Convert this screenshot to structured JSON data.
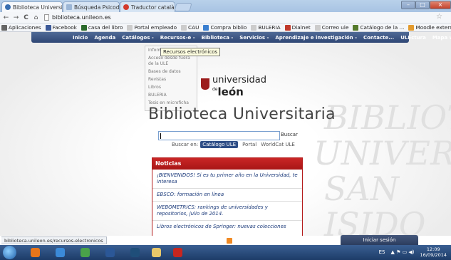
{
  "browser": {
    "tabs": [
      {
        "title": "Biblioteca Universita",
        "active": true,
        "icon_color": "#3a6fb0"
      },
      {
        "title": "Búsqueda Psicodoc",
        "active": false,
        "icon_color": "#9bb6d6"
      },
      {
        "title": "Traductor català / esp",
        "active": false,
        "icon_color": "#d33a2c"
      }
    ],
    "tab_close_glyph": "×",
    "address": "biblioteca.unileon.es",
    "nav": {
      "back": "←",
      "forward": "→",
      "reload": "C",
      "home": "⌂"
    },
    "star": "☆",
    "window_controls": {
      "minimize": "–",
      "maximize": "□",
      "close": "×"
    }
  },
  "bookmarks": [
    {
      "label": "Aplicaciones",
      "icon": "apps-icon",
      "color": "#666666"
    },
    {
      "label": "Facebook",
      "icon": "facebook-icon",
      "color": "#3b5998"
    },
    {
      "label": "casa del libro",
      "icon": "book-icon",
      "color": "#2c6b2c"
    },
    {
      "label": "Portal empleado",
      "icon": "page-icon",
      "color": "#cccccc"
    },
    {
      "label": "CAU",
      "icon": "cau-icon",
      "color": "#cccccc"
    },
    {
      "label": "Compra biblio",
      "icon": "cart-icon",
      "color": "#3a7fd0"
    },
    {
      "label": "BULERIA",
      "icon": "page-icon",
      "color": "#cccccc"
    },
    {
      "label": "Dialnet",
      "icon": "dialnet-icon",
      "color": "#c0392b"
    },
    {
      "label": "Correo ule",
      "icon": "page-icon",
      "color": "#cccccc"
    },
    {
      "label": "Catálogo de la ...",
      "icon": "catalog-icon",
      "color": "#557b2c"
    },
    {
      "label": "Moodle externo",
      "icon": "moodle-icon",
      "color": "#e39b2f"
    }
  ],
  "topnav": [
    "Inicio",
    "Agenda",
    "Catálogos -",
    "Recursos-e -",
    "Biblioteca -",
    "Servicios -",
    "Aprendizaje e investigación -",
    "Contacte...",
    "ULEctura",
    "Mapa web"
  ],
  "dropdown": {
    "items": [
      "Inform",
      "Acceso desde fuera de la ULE",
      "Bases de datos",
      "Revistas",
      "Libros",
      "BULERIA",
      "Tesis en microficha"
    ],
    "tooltip": "Recursos electrónicos"
  },
  "logo": {
    "line1": "universidad",
    "prefix": "de",
    "line2": "león"
  },
  "site_title": "Biblioteca Universitaria",
  "search": {
    "value": "",
    "button": "Buscar",
    "label": "Buscar en:",
    "options": [
      "Catálogo ULE",
      "Portal",
      "WorldCat ULE"
    ],
    "selected": "Catálogo ULE"
  },
  "news": {
    "title": "Noticias",
    "items": [
      "¡BIENVENIDOS! Si es tu primer año en la Universidad, te interesa",
      "EBSCO: formación en línea",
      "WEBOMETRICS: rankings de universidades y repositorios, julio de 2014.",
      "Libros electrónicos de Springer: nuevas colecciones"
    ]
  },
  "watermark": [
    "BIBLIOTE",
    "UNIVERSITA",
    "SAN ISIDO"
  ],
  "status_url": "biblioteca.unileon.es/recursos-electronicos",
  "login_label": "Iniciar sesión",
  "taskbar": {
    "apps": [
      {
        "name": "firefox",
        "color": "#e8751a"
      },
      {
        "name": "chrome-old",
        "color": "#3b8ad8"
      },
      {
        "name": "chrome",
        "color": "#4aa34a"
      },
      {
        "name": "word",
        "color": "#2b5797"
      },
      {
        "name": "media-player",
        "color": "#1f4e79"
      },
      {
        "name": "explorer",
        "color": "#e8c86a"
      },
      {
        "name": "acrobat",
        "color": "#c7261f"
      }
    ],
    "lang": "ES",
    "tray_icons": "▲ ⚑ ▭ ◀)",
    "time": "12:09",
    "date": "16/09/2014"
  }
}
